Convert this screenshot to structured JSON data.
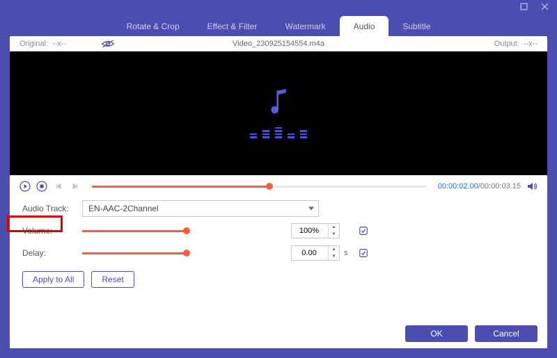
{
  "window": {
    "maximize": "maximize",
    "close": "close"
  },
  "tabs": {
    "rotate": "Rotate & Crop",
    "effect": "Effect & Filter",
    "watermark": "Watermark",
    "audio": "Audio",
    "subtitle": "Subtitle"
  },
  "infobar": {
    "original_label": "Original:",
    "original_value": "--x--",
    "filename": "Video_230925154554.m4a",
    "output_label": "Output:",
    "output_value": "--x--"
  },
  "playback": {
    "current_time": "00:00:02.00",
    "total_time": "/00:00:03.15",
    "progress_percent": 53
  },
  "form": {
    "audio_track_label": "Audio Track:",
    "audio_track_value": "EN-AAC-2Channel",
    "volume_label": "Volume:",
    "volume_value": "100%",
    "volume_percent": 100,
    "delay_label": "Delay:",
    "delay_value": "0.00",
    "delay_unit": "s",
    "delay_percent": 100
  },
  "buttons": {
    "apply_all": "Apply to All",
    "reset": "Reset",
    "ok": "OK",
    "cancel": "Cancel"
  }
}
